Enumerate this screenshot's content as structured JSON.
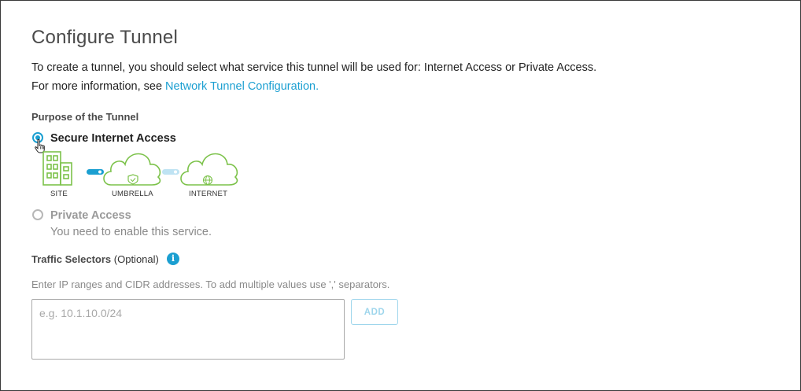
{
  "page": {
    "title": "Configure Tunnel",
    "description_line1": "To create a tunnel, you should select what service this tunnel will be used for: Internet Access or Private Access.",
    "description_line2_prefix": "For more information, see ",
    "description_link": "Network Tunnel Configuration."
  },
  "purpose": {
    "label": "Purpose of the Tunnel",
    "options": [
      {
        "label": "Secure Internet Access",
        "selected": true
      },
      {
        "label": "Private Access",
        "selected": false,
        "sublabel": "You need to enable this service."
      }
    ],
    "diagram": {
      "site_label": "SITE",
      "umbrella_label": "UMBRELLA",
      "internet_label": "INTERNET"
    }
  },
  "traffic": {
    "label_bold": "Traffic Selectors",
    "label_optional": " (Optional)",
    "hint": "Enter IP ranges and CIDR addresses. To add multiple values use ',' separators.",
    "input_placeholder": "e.g. 10.1.10.0/24",
    "add_button": "ADD"
  },
  "colors": {
    "accent": "#1b9fd1",
    "diagram_green": "#7cc24a",
    "disabled_text": "#9a9a9a"
  },
  "icons": {
    "info": "info-icon",
    "site": "building-icon",
    "umbrella": "cloud-shield-icon",
    "internet": "cloud-globe-icon"
  }
}
